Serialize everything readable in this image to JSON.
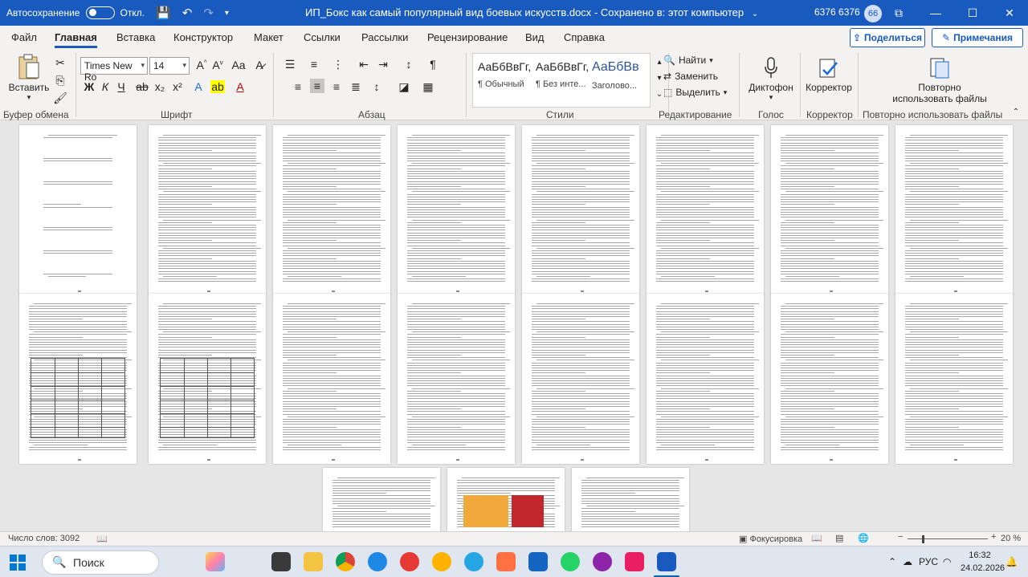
{
  "titlebar": {
    "autosave_label": "Автосохранение",
    "autosave_state": "Откл.",
    "document_title": "ИП_Бокс как самый популярный вид боевых искусств.docx",
    "save_status": "Сохранено в: этот компьютер",
    "user_name": "6376 6376",
    "avatar_initials": "66"
  },
  "tabs": [
    "Файл",
    "Главная",
    "Вставка",
    "Конструктор",
    "Макет",
    "Ссылки",
    "Рассылки",
    "Рецензирование",
    "Вид",
    "Справка"
  ],
  "share_label": "Поделиться",
  "comments_label": "Примечания",
  "ribbon": {
    "clipboard": {
      "paste_label": "Вставить",
      "group_label": "Буфер обмена"
    },
    "font": {
      "font_name": "Times New Ro",
      "font_size": "14",
      "group_label": "Шрифт"
    },
    "paragraph": {
      "group_label": "Абзац"
    },
    "styles": {
      "items": [
        {
          "sample": "АаБбВвГг,",
          "name": "¶ Обычный"
        },
        {
          "sample": "АаБбВвГг,",
          "name": "¶ Без инте..."
        },
        {
          "sample": "АаБбВв",
          "name": "Заголово..."
        }
      ],
      "group_label": "Стили"
    },
    "editing": {
      "find_label": "Найти",
      "replace_label": "Заменить",
      "select_label": "Выделить",
      "group_label": "Редактирование"
    },
    "voice": {
      "dictate_label": "Диктофон",
      "group_label": "Голос"
    },
    "editor": {
      "editor_label": "Корректор",
      "group_label": "Корректор"
    },
    "reuse": {
      "reuse_label_1": "Повторно",
      "reuse_label_2": "использовать файлы",
      "group_label": "Повторно использовать файлы"
    }
  },
  "statusbar": {
    "word_count": "Число слов: 3092",
    "focus_label": "Фокусировка",
    "zoom": "20 %"
  },
  "taskbar": {
    "search_label": "Поиск",
    "lang": "РУС",
    "time": "16:32",
    "date": "24.02.2026"
  },
  "colors": {
    "accent": "#185abd",
    "ribbon": "#f3f2f1",
    "canvas": "#e6e6e6"
  }
}
